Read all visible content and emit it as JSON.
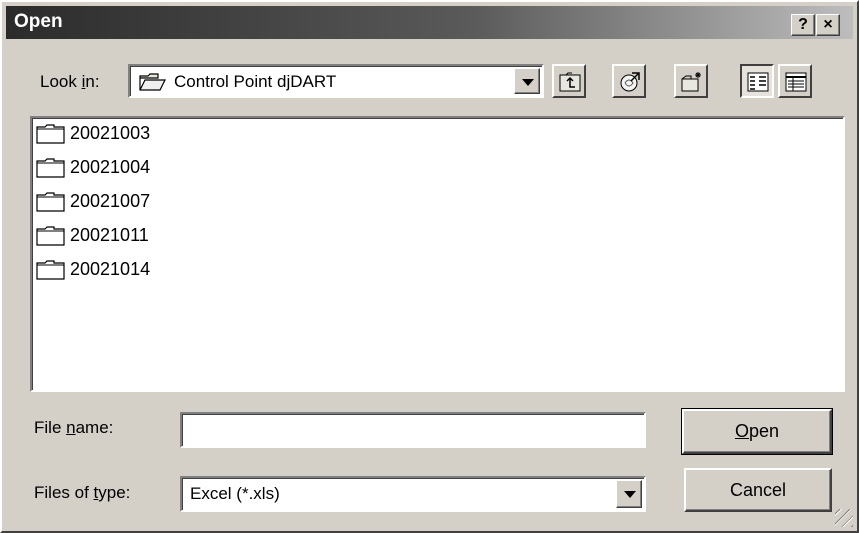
{
  "window": {
    "title": "Open",
    "help_label": "?",
    "close_label": "×"
  },
  "look_in": {
    "label_prefix": "Look ",
    "label_accel": "i",
    "label_suffix": "n:",
    "value": "Control Point djDART",
    "icon": "folder-open-icon"
  },
  "toolbar": {
    "buttons": [
      {
        "name": "up-one-level",
        "icon": "folder-up-icon"
      },
      {
        "name": "search-web",
        "icon": "web-search-icon"
      },
      {
        "name": "create-new-folder",
        "icon": "new-folder-icon"
      },
      {
        "name": "list-view",
        "icon": "list-view-icon",
        "pressed": true
      },
      {
        "name": "details-view",
        "icon": "details-view-icon",
        "pressed": false
      }
    ]
  },
  "files": [
    {
      "name": "20021003",
      "icon": "folder-icon"
    },
    {
      "name": "20021004",
      "icon": "folder-icon"
    },
    {
      "name": "20021007",
      "icon": "folder-icon"
    },
    {
      "name": "20021011",
      "icon": "folder-icon"
    },
    {
      "name": "20021014",
      "icon": "folder-icon"
    }
  ],
  "file_name": {
    "label_prefix": "File ",
    "label_accel": "n",
    "label_suffix": "ame:",
    "value": ""
  },
  "file_type": {
    "label_prefix": "Files of ",
    "label_accel": "t",
    "label_suffix": "ype:",
    "value": "Excel (*.xls)"
  },
  "buttons": {
    "open_accel": "O",
    "open_rest": "pen",
    "cancel": "Cancel"
  },
  "colors": {
    "face": "#d4d0c8",
    "title_dark": "#2b2b2b",
    "title_light": "#bdbdbd"
  }
}
